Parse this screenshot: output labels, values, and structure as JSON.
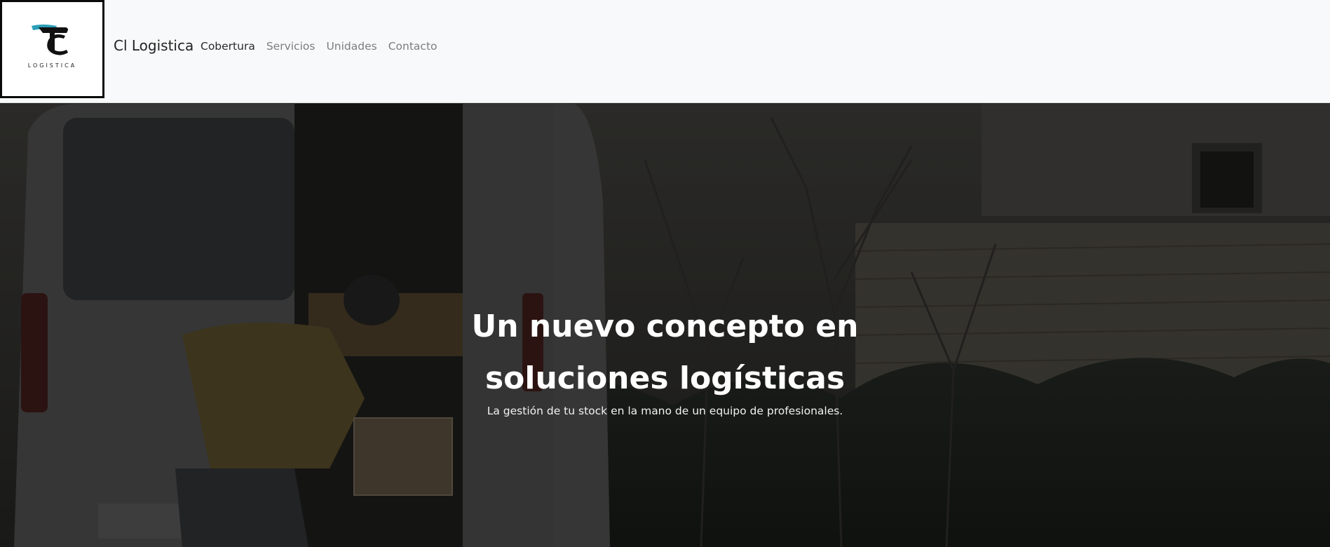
{
  "header": {
    "logo": {
      "icon": "tl-monogram-logo",
      "subtitle": "LOGISTICA"
    },
    "brand": "Cl Logistica",
    "nav": [
      {
        "label": "Cobertura",
        "active": true
      },
      {
        "label": "Servicios",
        "active": false
      },
      {
        "label": "Unidades",
        "active": false
      },
      {
        "label": "Contacto",
        "active": false
      }
    ]
  },
  "hero": {
    "title_line1": "Un nuevo concepto en",
    "title_line2": "soluciones logísticas",
    "subtitle": "La gestión de tu stock en la mano de un equipo de profesionales.",
    "background": "photo of courier loading a box into the back of a white delivery van beside trees and a brick wall, darkened overlay"
  },
  "colors": {
    "navbar_bg": "#f8f9fa",
    "nav_active": "#2a2a2a",
    "nav_inactive": "#7d7d7d",
    "logo_accent": "#2a9fb8",
    "hero_text": "#ffffff"
  }
}
